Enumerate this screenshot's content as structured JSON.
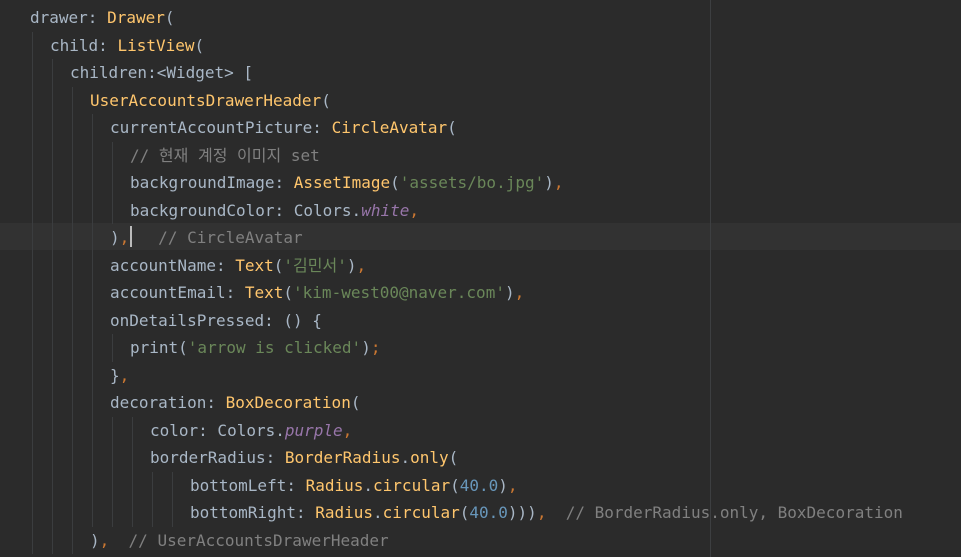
{
  "editor": {
    "lines": [
      [
        {
          "t": "drawer: ",
          "c": "prop"
        },
        {
          "t": "Drawer",
          "c": "class"
        },
        {
          "t": "(",
          "c": "punct"
        }
      ],
      [
        {
          "t": "child: ",
          "c": "prop"
        },
        {
          "t": "ListView",
          "c": "class"
        },
        {
          "t": "(",
          "c": "punct"
        }
      ],
      [
        {
          "t": "children:<Widget> [",
          "c": "prop"
        }
      ],
      [
        {
          "t": "UserAccountsDrawerHeader",
          "c": "class"
        },
        {
          "t": "(",
          "c": "punct"
        }
      ],
      [
        {
          "t": "currentAccountPicture: ",
          "c": "prop"
        },
        {
          "t": "CircleAvatar",
          "c": "class"
        },
        {
          "t": "(",
          "c": "punct"
        }
      ],
      [
        {
          "t": "// 현재 계정 이미지 set",
          "c": "comment"
        }
      ],
      [
        {
          "t": "backgroundImage: ",
          "c": "prop"
        },
        {
          "t": "AssetImage",
          "c": "class"
        },
        {
          "t": "(",
          "c": "punct"
        },
        {
          "t": "'assets/bo.jpg'",
          "c": "string"
        },
        {
          "t": ")",
          "c": "punct"
        },
        {
          "t": ",",
          "c": "kw"
        }
      ],
      [
        {
          "t": "backgroundColor: Colors.",
          "c": "prop"
        },
        {
          "t": "white",
          "c": "static"
        },
        {
          "t": ",",
          "c": "kw"
        }
      ],
      [
        {
          "t": ")",
          "c": "punct"
        },
        {
          "t": ",",
          "c": "kw"
        },
        {
          "t": "   // CircleAvatar",
          "c": "comment"
        }
      ],
      [
        {
          "t": "accountName: ",
          "c": "prop"
        },
        {
          "t": "Text",
          "c": "class"
        },
        {
          "t": "(",
          "c": "punct"
        },
        {
          "t": "'김민서'",
          "c": "string"
        },
        {
          "t": ")",
          "c": "punct"
        },
        {
          "t": ",",
          "c": "kw"
        }
      ],
      [
        {
          "t": "accountEmail: ",
          "c": "prop"
        },
        {
          "t": "Text",
          "c": "class"
        },
        {
          "t": "(",
          "c": "punct"
        },
        {
          "t": "'kim-west00@naver.com'",
          "c": "string"
        },
        {
          "t": ")",
          "c": "punct"
        },
        {
          "t": ",",
          "c": "kw"
        }
      ],
      [
        {
          "t": "onDetailsPressed: () {",
          "c": "prop"
        }
      ],
      [
        {
          "t": "print(",
          "c": "prop"
        },
        {
          "t": "'arrow is clicked'",
          "c": "string"
        },
        {
          "t": ")",
          "c": "punct"
        },
        {
          "t": ";",
          "c": "kw"
        }
      ],
      [
        {
          "t": "}",
          "c": "punct"
        },
        {
          "t": ",",
          "c": "kw"
        }
      ],
      [
        {
          "t": "decoration: ",
          "c": "prop"
        },
        {
          "t": "BoxDecoration",
          "c": "class"
        },
        {
          "t": "(",
          "c": "punct"
        }
      ],
      [
        {
          "t": "color: Colors.",
          "c": "prop"
        },
        {
          "t": "purple",
          "c": "static"
        },
        {
          "t": ",",
          "c": "kw"
        }
      ],
      [
        {
          "t": "borderRadius: ",
          "c": "prop"
        },
        {
          "t": "BorderRadius",
          "c": "class"
        },
        {
          "t": ".",
          "c": "punct"
        },
        {
          "t": "only",
          "c": "method"
        },
        {
          "t": "(",
          "c": "punct"
        }
      ],
      [
        {
          "t": "bottomLeft: ",
          "c": "prop"
        },
        {
          "t": "Radius",
          "c": "class"
        },
        {
          "t": ".",
          "c": "punct"
        },
        {
          "t": "circular",
          "c": "method"
        },
        {
          "t": "(",
          "c": "punct"
        },
        {
          "t": "40.0",
          "c": "number"
        },
        {
          "t": ")",
          "c": "punct"
        },
        {
          "t": ",",
          "c": "kw"
        }
      ],
      [
        {
          "t": "bottomRight: ",
          "c": "prop"
        },
        {
          "t": "Radius",
          "c": "class"
        },
        {
          "t": ".",
          "c": "punct"
        },
        {
          "t": "circular",
          "c": "method"
        },
        {
          "t": "(",
          "c": "punct"
        },
        {
          "t": "40.0",
          "c": "number"
        },
        {
          "t": ")))",
          "c": "punct"
        },
        {
          "t": ",",
          "c": "kw"
        },
        {
          "t": "  // BorderRadius.only, BoxDecoration",
          "c": "comment"
        }
      ],
      [
        {
          "t": ")",
          "c": "punct"
        },
        {
          "t": ",",
          "c": "kw"
        },
        {
          "t": "  // UserAccountsDrawerHeader",
          "c": "comment"
        }
      ]
    ]
  },
  "colors": {
    "background": "#2b2b2b",
    "current_line": "#323232",
    "property": "#a9b7c6",
    "class": "#ffc66d",
    "keyword": "#cc7832",
    "string": "#6a8759",
    "number": "#6897bb",
    "static": "#9876aa",
    "comment": "#808080"
  }
}
